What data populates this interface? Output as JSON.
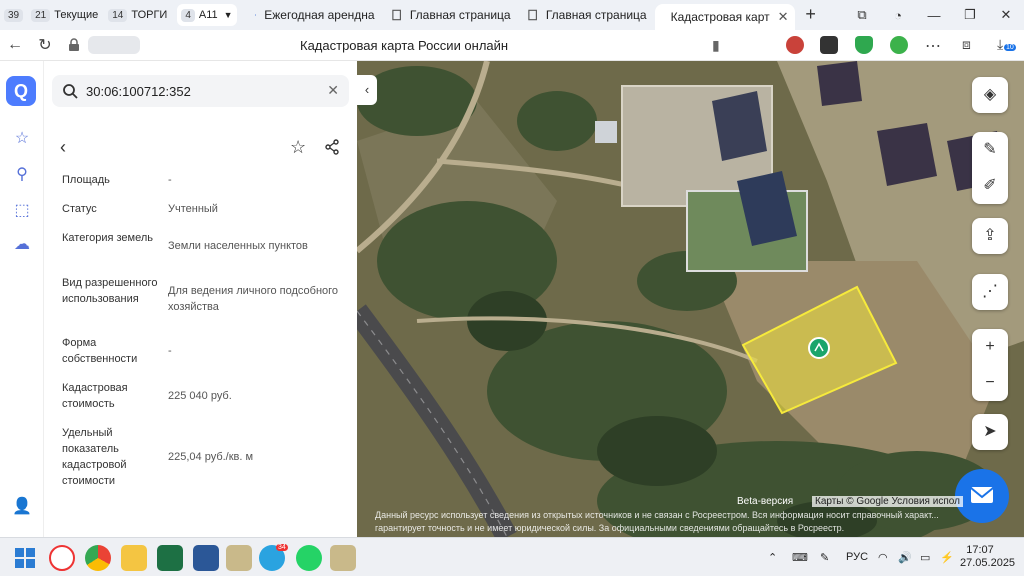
{
  "tab_groups": [
    {
      "count": "39",
      "label": ""
    },
    {
      "count": "21",
      "label": "Текущие"
    },
    {
      "count": "14",
      "label": "ТОРГИ"
    },
    {
      "count": "4",
      "label": "А11"
    }
  ],
  "tabs": [
    {
      "label": "Ежегодная арендна",
      "icon": "emblem-icon"
    },
    {
      "label": "Главная страница",
      "icon": "page-icon"
    },
    {
      "label": "Главная страница",
      "icon": "page-icon"
    },
    {
      "label": "Кадастровая карт",
      "icon": "cadastre-icon",
      "active": true
    }
  ],
  "page_title": "Кадастровая карта России онлайн",
  "download_badge": "10",
  "search": {
    "value": "30:06:100712:352"
  },
  "parcel": [
    {
      "key": "Площадь",
      "value": "-"
    },
    {
      "key": "Статус",
      "value": "Учтенный"
    },
    {
      "key": "Категория земель",
      "value": "Земли населенных пунктов"
    },
    {
      "key": "Вид разрешенного использования",
      "value": "Для ведения личного подсобного хозяйства"
    },
    {
      "key": "Форма собственности",
      "value": "-"
    },
    {
      "key": "Кадастровая стоимость",
      "value": "225 040 руб."
    },
    {
      "key": "Удельный показатель кадастровой стоимости",
      "value": "225,04 руб./кв. м"
    }
  ],
  "map": {
    "beta": "Beta-версия",
    "attribution": "Карты © Google   Условия испол",
    "disclaimer": "Данный ресурс использует сведения из открытых источников и не связан с Росреестром. Вся информация носит справочный характ... гарантирует точность и не имеет юридической силы. За официальными сведениями обращайтесь в Росреестр.",
    "parcel_color": "#f2e33a"
  },
  "taskbar": {
    "language": "РУС",
    "time": "17:07",
    "date": "27.05.2025",
    "telegram_badge": "34"
  }
}
